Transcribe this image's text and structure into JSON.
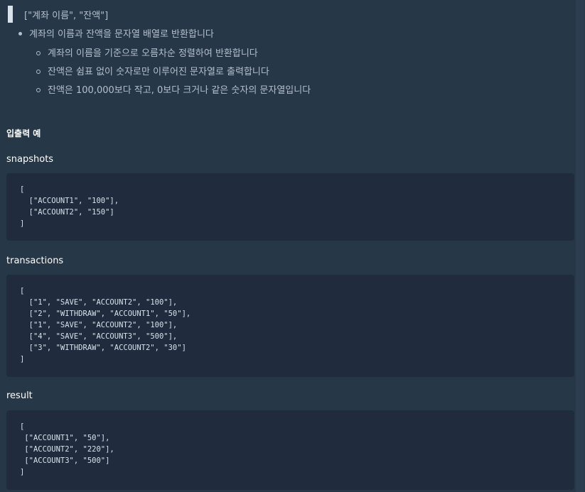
{
  "quote": {
    "text": "[\"계좌 이름\", \"잔액\"]"
  },
  "bullets": {
    "main": "계좌의 이름과 잔액을 문자열 배열로 반환합니다",
    "sub": [
      "계좌의 이름을 기준으로 오름차순 정렬하여 반환합니다",
      "잔액은 쉼표 없이 숫자로만 이루어진 문자열로 출력합니다",
      "잔액은 100,000보다 작고, 0보다 크거나 같은 숫자의 문자열입니다"
    ]
  },
  "examples_heading": "입출력 예",
  "snapshots": {
    "label": "snapshots",
    "lines": [
      "[",
      "  [\"ACCOUNT1\", \"100\"],",
      "  [\"ACCOUNT2\", \"150\"]",
      "]"
    ]
  },
  "transactions": {
    "label": "transactions",
    "lines": [
      "[",
      "  [\"1\", \"SAVE\", \"ACCOUNT2\", \"100\"],",
      "  [\"2\", \"WITHDRAW\", \"ACCOUNT1\", \"50\"],",
      "  [\"1\", \"SAVE\", \"ACCOUNT2\", \"100\"],",
      "  [\"4\", \"SAVE\", \"ACCOUNT3\", \"500\"],",
      "  [\"3\", \"WITHDRAW\", \"ACCOUNT2\", \"30\"]",
      "]"
    ]
  },
  "result": {
    "label": "result",
    "lines": [
      "[",
      " [\"ACCOUNT1\", \"50\"],",
      " [\"ACCOUNT2\", \"220\"],",
      " [\"ACCOUNT3\", \"500\"]",
      "]"
    ]
  },
  "colors": {
    "background": "#263747",
    "code_background": "#202b3d",
    "text": "#b2c0cc",
    "heading": "#ffffff"
  }
}
